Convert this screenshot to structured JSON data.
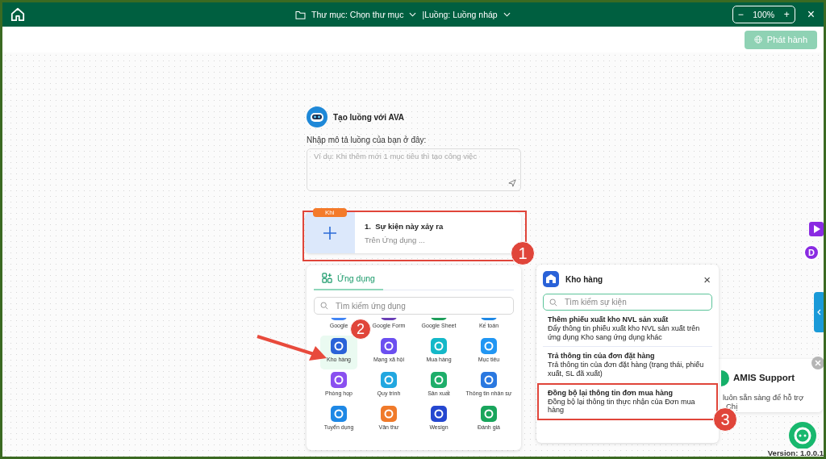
{
  "top_bar": {
    "folder": "Thư mục: Chọn thư mục",
    "flow": "|Luồng: Luồng nháp",
    "zoom": "100%",
    "zoom_out": "−",
    "zoom_in": "+",
    "close": "×"
  },
  "publish_button": {
    "label": "Phát hành",
    "disabled": true
  },
  "ava": {
    "title": "Tạo luồng với AVA",
    "prompt_label": "Nhập mô tả luồng của bạn ở đây:",
    "placeholder": "Ví dụ: Khi thêm mới 1 mục tiêu thì tạo công việc"
  },
  "trigger": {
    "tag": "Khi",
    "title": "1.  Sự kiện này xảy ra",
    "subtitle": "Trên Ứng dụng ..."
  },
  "apps_panel": {
    "tab": "Ứng dụng",
    "search_placeholder": "Tìm kiếm ứng dụng",
    "apps": [
      {
        "name": "Google",
        "color": "#4285f4",
        "selected": false
      },
      {
        "name": "Google Form",
        "color": "#6a3fb5",
        "selected": false
      },
      {
        "name": "Google Sheet",
        "color": "#1e9e5a",
        "selected": false
      },
      {
        "name": "Kế toán",
        "color": "#1e88e5",
        "selected": false
      },
      {
        "name": "Kho hàng",
        "color": "#2a62d8",
        "selected": true
      },
      {
        "name": "Mạng xã hội",
        "color": "#6b4ff0",
        "selected": false
      },
      {
        "name": "Mua hàng",
        "color": "#14b8c8",
        "selected": false
      },
      {
        "name": "Mục tiêu",
        "color": "#2196f3",
        "selected": false
      },
      {
        "name": "Phòng họp",
        "color": "#8a4ff0",
        "selected": false
      },
      {
        "name": "Quy trình",
        "color": "#22a7e0",
        "selected": false
      },
      {
        "name": "Sản xuất",
        "color": "#1eae6a",
        "selected": false
      },
      {
        "name": "Thông tin nhân sự",
        "color": "#2a78e0",
        "selected": false
      },
      {
        "name": "Tuyển dụng",
        "color": "#1e88e5",
        "selected": false
      },
      {
        "name": "Văn thư",
        "color": "#f07a2a",
        "selected": false
      },
      {
        "name": "Wesign",
        "color": "#2547d0",
        "selected": false
      },
      {
        "name": "Đánh giá",
        "color": "#19a55c",
        "selected": false
      }
    ]
  },
  "event_panel": {
    "title": "Kho hàng",
    "close": "×",
    "search_placeholder": "Tìm kiếm sự kiện",
    "events": [
      {
        "title": "Thêm phiếu xuất kho NVL sản xuất",
        "description": "Đẩy thông tin phiếu xuất kho NVL sản xuất trên ứng dụng Kho sang ứng dụng khác",
        "highlighted": false
      },
      {
        "title": "Trả thông tin của đơn đặt hàng",
        "description": "Trả thông tin của đơn đặt hàng (trạng thái, phiếu xuất, SL đã xuất)",
        "highlighted": false
      },
      {
        "title": "Đồng bộ lại thông tin đơn mua hàng",
        "description": "Đồng bộ lại thông tin thực nhận của Đơn mua hàng",
        "highlighted": true
      }
    ]
  },
  "support_popup": {
    "title": "AMIS Support",
    "lines": [
      "luôn sẵn sàng để hỗ trợ",
      "Chị"
    ]
  },
  "side_badge": "D",
  "version": "Version: 1.0.0.1",
  "annotations": [
    {
      "label": "1"
    },
    {
      "label": "2"
    },
    {
      "label": "3"
    }
  ]
}
